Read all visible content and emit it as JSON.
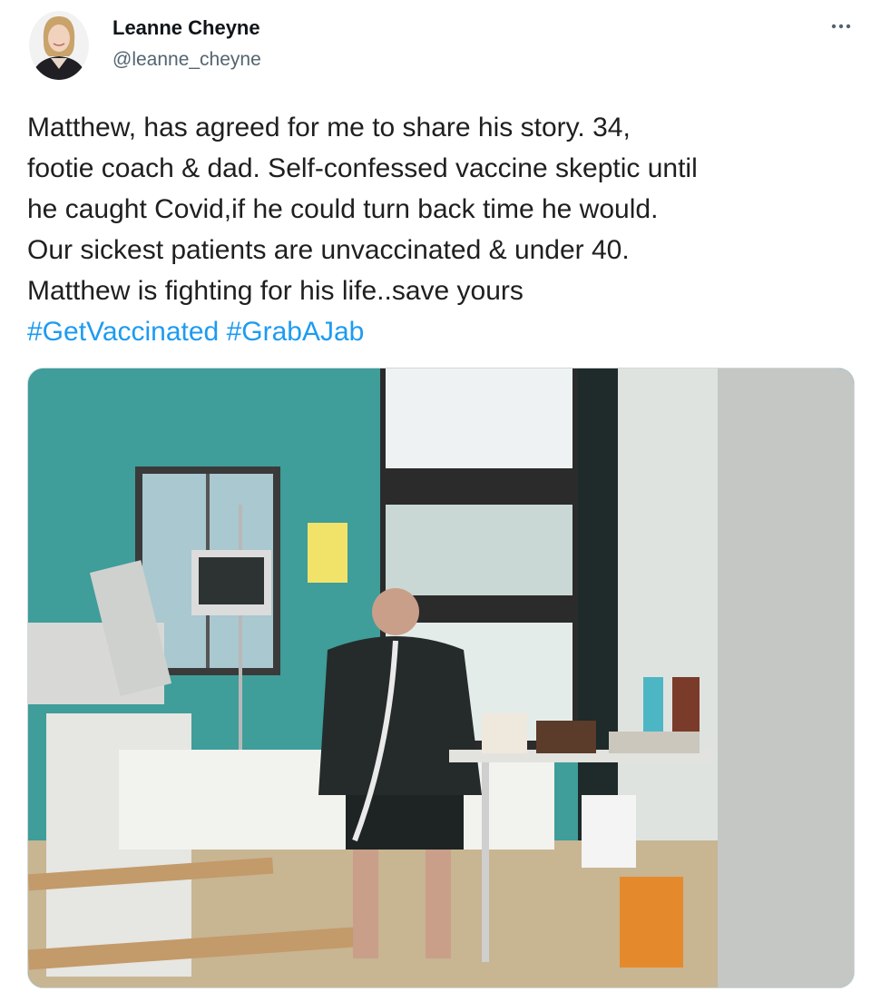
{
  "author": {
    "name": "Leanne Cheyne",
    "handle": "@leanne_cheyne"
  },
  "tweet": {
    "lines": [
      "Matthew, has agreed for me to share his story. 34,",
      "footie coach & dad. Self-confessed vaccine skeptic until",
      "he caught Covid,if he could turn back time he would.",
      "Our sickest patients are unvaccinated & under 40.",
      "Matthew is fighting for his life..save yours"
    ],
    "hashtags": [
      "#GetVaccinated",
      "#GrabAJab"
    ]
  },
  "icons": {
    "more": "more-horizontal-icon",
    "avatar": "user-avatar-photo"
  },
  "colors": {
    "hashtag": "#1d9bf0",
    "handle": "#536471",
    "wall": "#3f9d9a"
  }
}
